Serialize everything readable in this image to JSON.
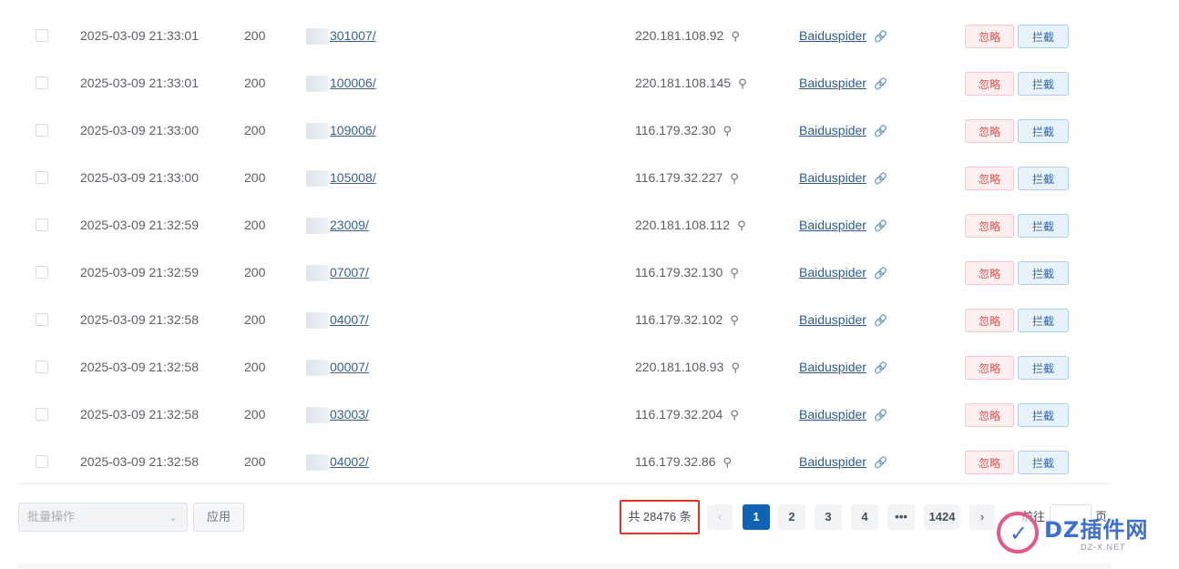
{
  "rows": [
    {
      "time": "2025-03-09 21:33:01",
      "status": "200",
      "url": "301007/",
      "ip": "220.181.108.92",
      "bot": "Baiduspider"
    },
    {
      "time": "2025-03-09 21:33:01",
      "status": "200",
      "url": "100006/",
      "ip": "220.181.108.145",
      "bot": "Baiduspider"
    },
    {
      "time": "2025-03-09 21:33:00",
      "status": "200",
      "url": "109006/",
      "ip": "116.179.32.30",
      "bot": "Baiduspider"
    },
    {
      "time": "2025-03-09 21:33:00",
      "status": "200",
      "url": "105008/",
      "ip": "116.179.32.227",
      "bot": "Baiduspider"
    },
    {
      "time": "2025-03-09 21:32:59",
      "status": "200",
      "url": "23009/",
      "ip": "220.181.108.112",
      "bot": "Baiduspider"
    },
    {
      "time": "2025-03-09 21:32:59",
      "status": "200",
      "url": "07007/",
      "ip": "116.179.32.130",
      "bot": "Baiduspider"
    },
    {
      "time": "2025-03-09 21:32:58",
      "status": "200",
      "url": "04007/",
      "ip": "116.179.32.102",
      "bot": "Baiduspider"
    },
    {
      "time": "2025-03-09 21:32:58",
      "status": "200",
      "url": "00007/",
      "ip": "220.181.108.93",
      "bot": "Baiduspider"
    },
    {
      "time": "2025-03-09 21:32:58",
      "status": "200",
      "url": "03003/",
      "ip": "116.179.32.204",
      "bot": "Baiduspider"
    },
    {
      "time": "2025-03-09 21:32:58",
      "status": "200",
      "url": "04002/",
      "ip": "116.179.32.86",
      "bot": "Baiduspider"
    }
  ],
  "actions": {
    "ignore_label": "忽略",
    "block_label": "拦截"
  },
  "icons": {
    "search": "search-icon",
    "link": "link-icon"
  },
  "footer": {
    "bulk_placeholder": "批量操作",
    "apply_label": "应用",
    "total_text": "共 28476 条",
    "pages": [
      "1",
      "2",
      "3",
      "4",
      "•••",
      "1424"
    ],
    "current_page": "1",
    "prev": "‹",
    "next": "›",
    "goto_label": "前往",
    "goto_suffix": "页"
  },
  "watermark": {
    "text": "DZ插件网",
    "sub": "DZ-X.NET"
  },
  "colors": {
    "primary": "#1063b3",
    "danger": "#d9534f",
    "highlight_box": "#d9322e"
  }
}
